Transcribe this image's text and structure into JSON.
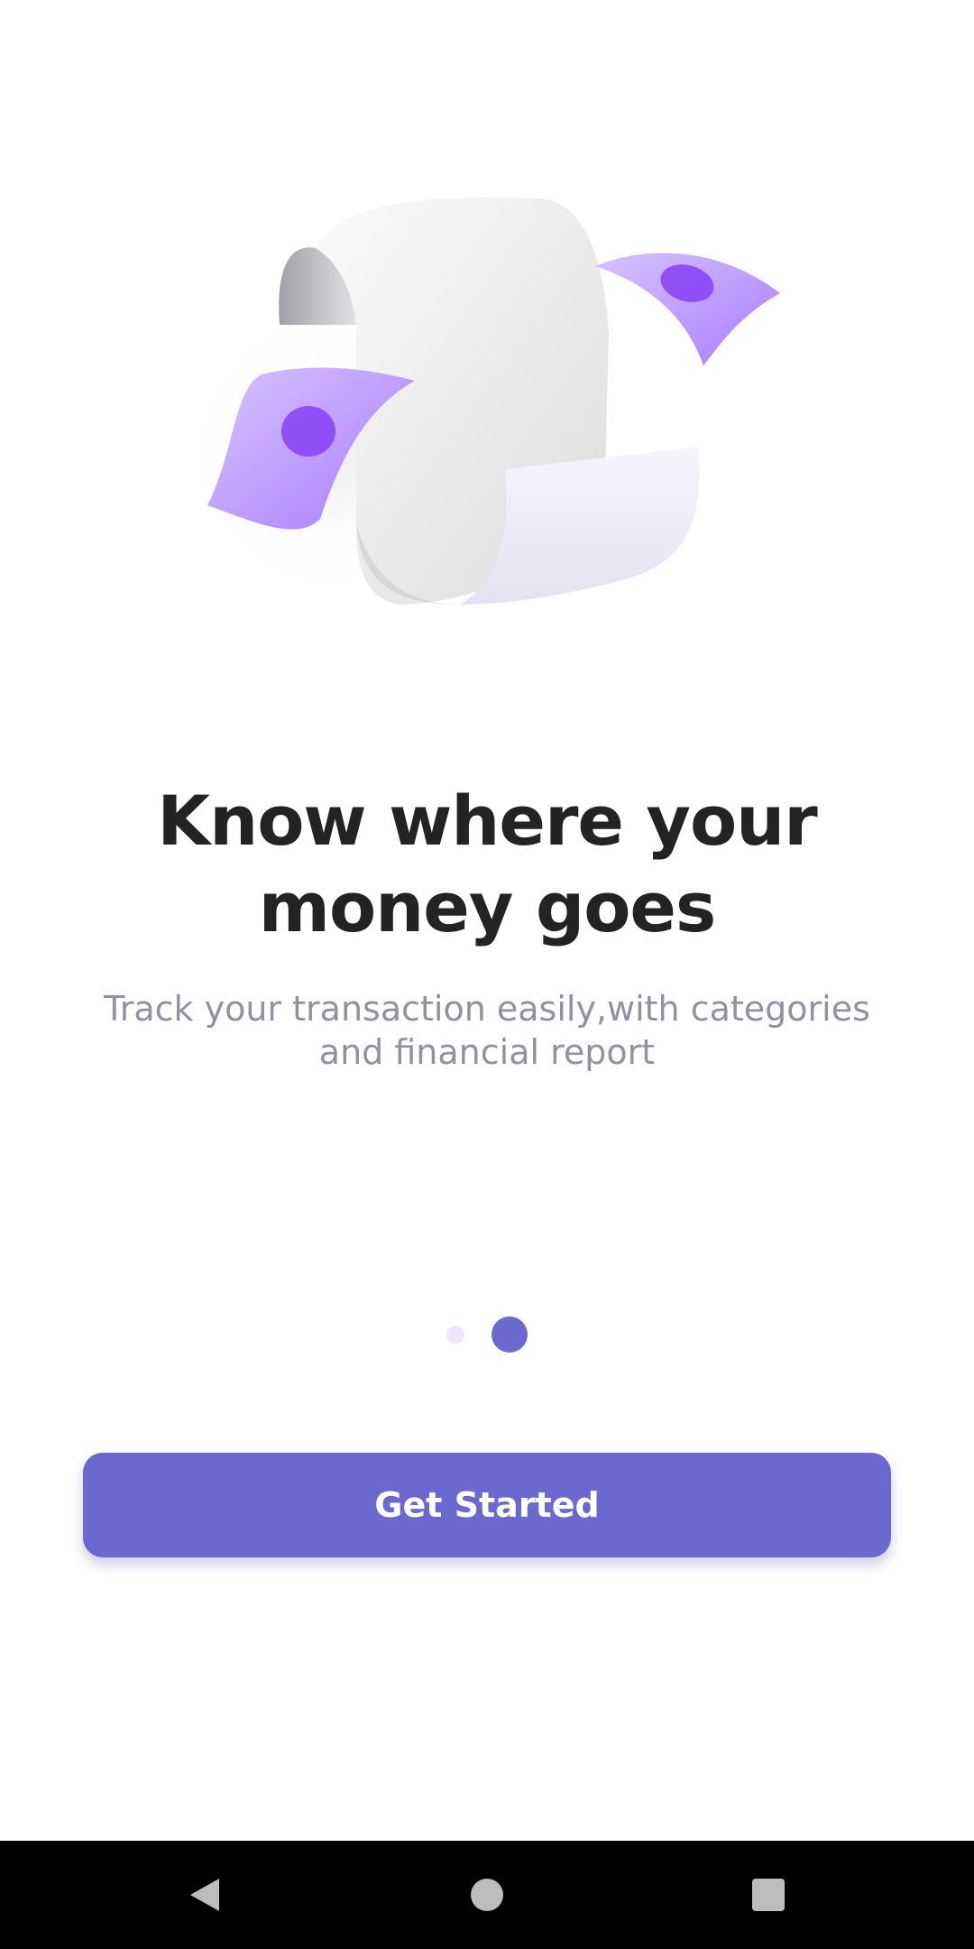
{
  "onboarding": {
    "title_line1": "Know where your",
    "title_line2": "money goes",
    "subtitle_line1": "Track your transaction easily,with categories",
    "subtitle_line2": "and financial report",
    "page_indicator": {
      "total": 2,
      "active": 2
    },
    "cta_label": "Get Started",
    "illustration_icon": "receipt-with-money-icon"
  },
  "nav_bar": {
    "back_icon": "back-triangle-icon",
    "home_icon": "home-circle-icon",
    "recent_icon": "recent-square-icon"
  },
  "colors": {
    "accent": "#6B68D0",
    "accent_light": "#EEE5FF",
    "title": "#212325",
    "subtitle": "#91919F",
    "money_purple": "#B68CFF"
  }
}
